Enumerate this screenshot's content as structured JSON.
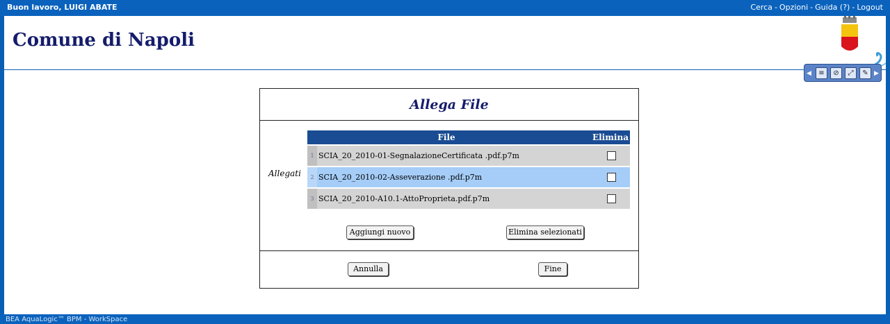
{
  "topbar": {
    "greeting": "Buon lavoro, LUIGI ABATE",
    "links": [
      {
        "label": "Cerca"
      },
      {
        "label": "Opzioni"
      },
      {
        "label": "Guida (?)"
      },
      {
        "label": "Logout"
      }
    ],
    "separator": "-"
  },
  "header": {
    "title": "Comune di Napoli",
    "crest_icon": "city-crest-icon"
  },
  "toolbar": {
    "buttons": [
      {
        "icon": "document-icon",
        "glyph": "≡"
      },
      {
        "icon": "attach-icon",
        "glyph": "⊘"
      },
      {
        "icon": "link-icon",
        "glyph": "⤢"
      },
      {
        "icon": "edit-icon",
        "glyph": "✎"
      }
    ]
  },
  "dialog": {
    "title": "Allega File",
    "section_label": "Allegati",
    "columns": {
      "file": "File",
      "delete": "Elimina"
    },
    "rows": [
      {
        "num": "1",
        "file": "SCIA_20_2010-01-SegnalazioneCertificata .pdf.p7m",
        "checked": false,
        "highlighted": false
      },
      {
        "num": "2",
        "file": "SCIA_20_2010-02-Asseverazione .pdf.p7m",
        "checked": false,
        "highlighted": true
      },
      {
        "num": "3",
        "file": "SCIA_20_2010-A10.1-AttoProprieta.pdf.p7m",
        "checked": false,
        "highlighted": false
      }
    ],
    "add_button": "Aggiungi nuovo",
    "delete_selected_button": "Elimina selezionati",
    "cancel_button": "Annulla",
    "finish_button": "Fine"
  },
  "footer": {
    "text": "BEA AquaLogic™ BPM - WorkSpace"
  },
  "colors": {
    "frame_blue": "#0a62bd",
    "title_navy": "#151c6b",
    "table_header": "#1a4c93",
    "row_highlight": "#a5cdf7"
  }
}
